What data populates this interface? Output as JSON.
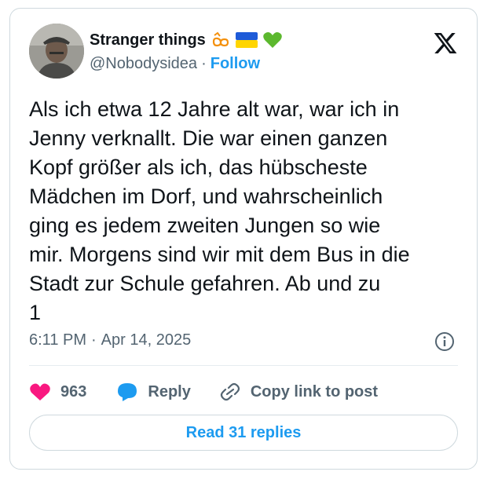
{
  "author": {
    "display_name": "Stranger things",
    "handle": "@Nobodysidea",
    "follow_label": "Follow",
    "badges": [
      "infinity-icon",
      "ukraine-flag-icon",
      "green-heart-icon"
    ]
  },
  "tweet": {
    "text": "Als ich etwa 12 Jahre alt war, war ich in\nJenny verknallt. Die war einen ganzen\nKopf größer als ich, das hübscheste\nMädchen im Dorf, und wahrscheinlich\nging es jedem zweiten Jungen so wie\nmir. Morgens sind wir mit dem Bus in die\nStadt zur Schule gefahren. Ab und zu\n1",
    "time": "6:11 PM",
    "separator": "·",
    "date": "Apr 14, 2025"
  },
  "actions": {
    "like_count": "963",
    "reply_label": "Reply",
    "copy_label": "Copy link to post"
  },
  "footer": {
    "read_replies_label": "Read 31 replies"
  },
  "colors": {
    "accent": "#1d9bf0",
    "like": "#f91880",
    "text": "#0f1419",
    "muted": "#536471",
    "border": "#cfd9de"
  }
}
